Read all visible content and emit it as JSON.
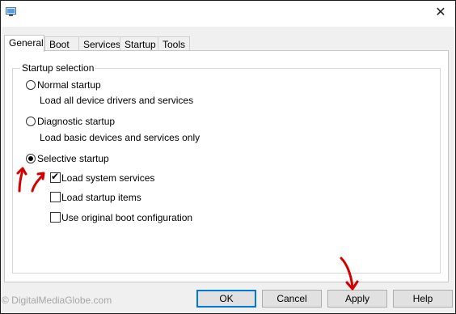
{
  "window": {
    "icon": "msconfig-icon",
    "close_glyph": "✕"
  },
  "tabs": [
    {
      "label": "General",
      "active": true
    },
    {
      "label": "Boot",
      "active": false
    },
    {
      "label": "Services",
      "active": false
    },
    {
      "label": "Startup",
      "active": false
    },
    {
      "label": "Tools",
      "active": false
    }
  ],
  "startup_selection": {
    "group_label": "Startup selection",
    "normal": {
      "label": "Normal startup",
      "desc": "Load all device drivers and services",
      "selected": false
    },
    "diagnostic": {
      "label": "Diagnostic startup",
      "desc": "Load basic devices and services only",
      "selected": false
    },
    "selective": {
      "label": "Selective startup",
      "selected": true
    },
    "options": [
      {
        "label": "Load system services",
        "checked": true
      },
      {
        "label": "Load startup items",
        "checked": false
      },
      {
        "label": "Use original boot configuration",
        "checked": false
      }
    ]
  },
  "buttons": {
    "ok": "OK",
    "cancel": "Cancel",
    "apply": "Apply",
    "help": "Help"
  },
  "watermark": "© DigitalMediaGlobe.com",
  "colors": {
    "annotation_arrows": "#d40000",
    "default_button_border": "#0078d7"
  }
}
